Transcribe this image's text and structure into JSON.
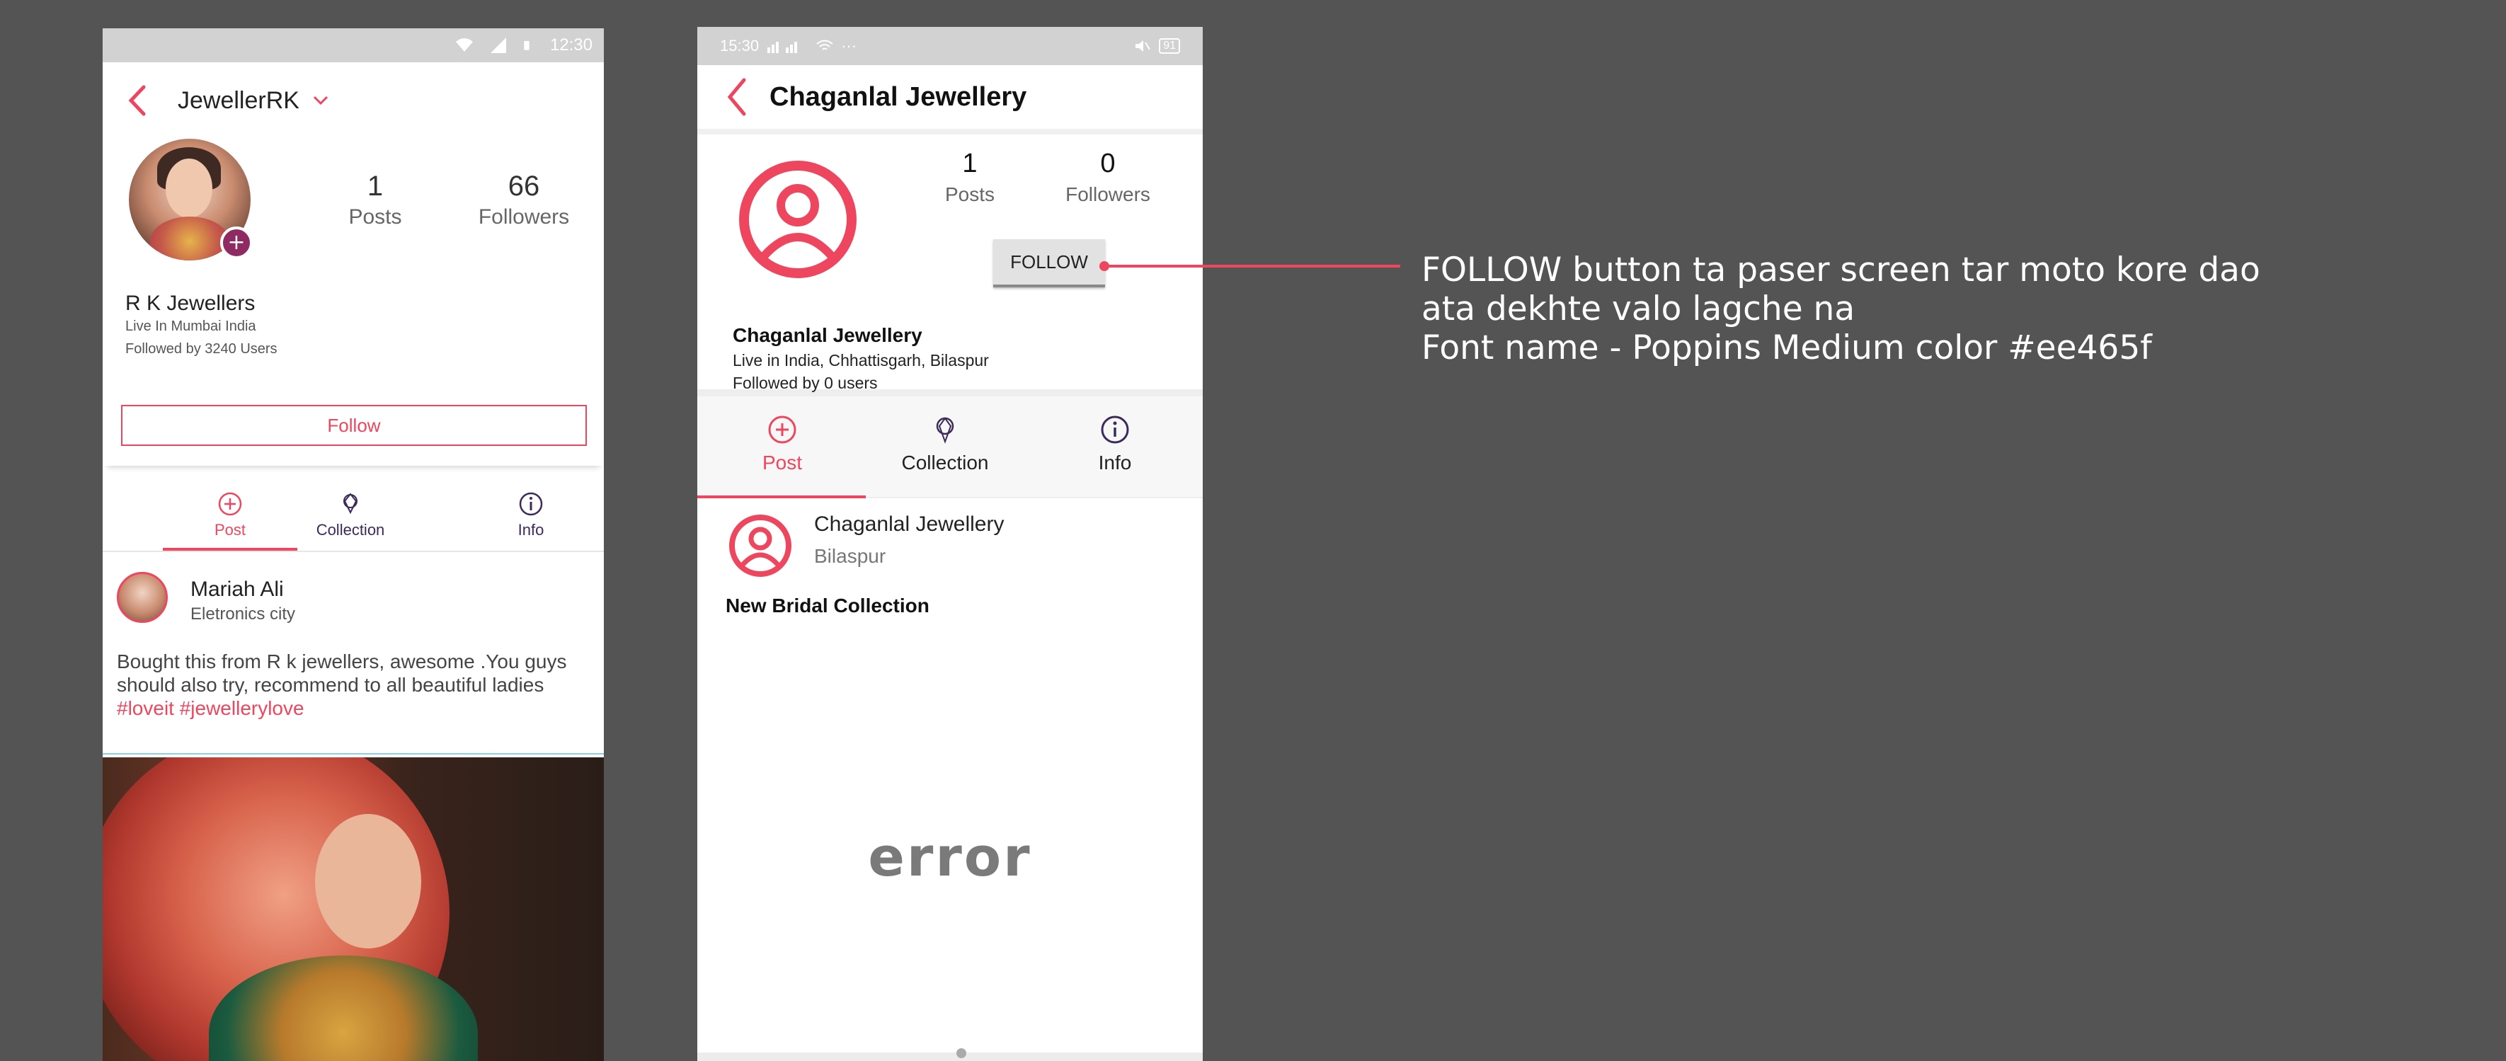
{
  "left_screen": {
    "status": {
      "time": "12:30"
    },
    "header": {
      "title": "JewellerRK"
    },
    "profile": {
      "posts_count": "1",
      "posts_label": "Posts",
      "followers_count": "66",
      "followers_label": "Followers",
      "name": "R K Jewellers",
      "location": "Live In Mumbai India",
      "followed_by": "Followed by 3240 Users",
      "follow_label": "Follow"
    },
    "tabs": [
      {
        "label": "Post",
        "icon": "plus-circle-icon",
        "active": true
      },
      {
        "label": "Collection",
        "icon": "ring-icon",
        "active": false
      },
      {
        "label": "Info",
        "icon": "info-icon",
        "active": false
      }
    ],
    "post": {
      "author": "Mariah Ali",
      "city": "Eletronics city",
      "text": "Bought this from R k jewellers, awesome .You guys should also try, recommend to all beautiful ladies ",
      "hashtags": "#loveit #jewellerylove"
    }
  },
  "right_screen": {
    "status": {
      "time": "15:30",
      "battery": "91"
    },
    "header": {
      "title": "Chaganlal Jewellery"
    },
    "profile": {
      "posts_count": "1",
      "posts_label": "Posts",
      "followers_count": "0",
      "followers_label": "Followers",
      "follow_label": "FOLLOW",
      "name": "Chaganlal Jewellery",
      "location": "Live in India, Chhattisgarh, Bilaspur",
      "followed_by": "Followed by 0 users"
    },
    "tabs": [
      {
        "label": "Post",
        "icon": "plus-circle-icon",
        "active": true
      },
      {
        "label": "Collection",
        "icon": "ring-icon",
        "active": false
      },
      {
        "label": "Info",
        "icon": "info-icon",
        "active": false
      }
    ],
    "post": {
      "author": "Chaganlal Jewellery",
      "city": "Bilaspur",
      "title": "New Bridal Collection",
      "image_error": "error"
    }
  },
  "annotation": {
    "lines": [
      "FOLLOW button ta paser screen tar moto kore dao",
      "ata dekhte valo lagche na",
      "Font name - Poppins Medium color #ee465f"
    ]
  },
  "colors": {
    "accent": "#ee465f",
    "tab_inactive": "#3b2a5a",
    "background": "#545454"
  }
}
